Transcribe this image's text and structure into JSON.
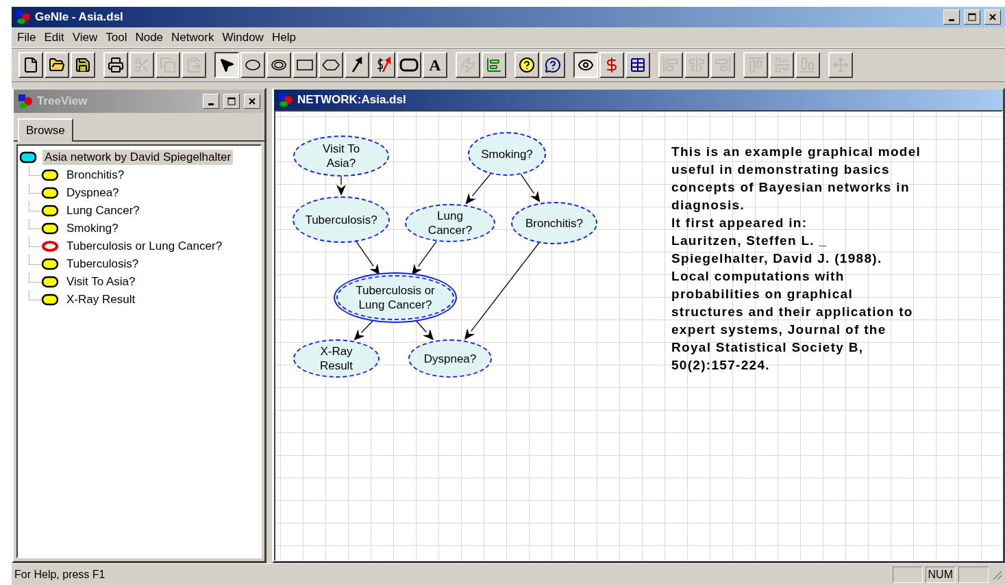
{
  "window": {
    "title": "GeNIe - Asia.dsl"
  },
  "menu": [
    "File",
    "Edit",
    "View",
    "Tool",
    "Node",
    "Network",
    "Window",
    "Help"
  ],
  "toolbar": [
    [
      {
        "kind": "new",
        "pressed": false,
        "disabled": false
      },
      {
        "kind": "open",
        "pressed": false,
        "disabled": false
      },
      {
        "kind": "save",
        "pressed": false,
        "disabled": false
      }
    ],
    [
      {
        "kind": "print",
        "pressed": false,
        "disabled": false
      },
      {
        "kind": "cut",
        "pressed": false,
        "disabled": true
      },
      {
        "kind": "copy",
        "pressed": false,
        "disabled": true
      },
      {
        "kind": "paste",
        "pressed": false,
        "disabled": true
      }
    ],
    [
      {
        "kind": "select",
        "pressed": true,
        "disabled": false
      },
      {
        "kind": "chance",
        "pressed": false,
        "disabled": false
      },
      {
        "kind": "deterministic",
        "pressed": false,
        "disabled": false
      },
      {
        "kind": "decision",
        "pressed": false,
        "disabled": false
      },
      {
        "kind": "utility",
        "pressed": false,
        "disabled": false
      },
      {
        "kind": "arc",
        "pressed": false,
        "disabled": false
      },
      {
        "kind": "value-arc",
        "pressed": false,
        "disabled": false
      },
      {
        "kind": "submodel",
        "pressed": false,
        "disabled": false
      },
      {
        "kind": "text",
        "label": "A",
        "pressed": false,
        "disabled": false
      }
    ],
    [
      {
        "kind": "strength",
        "pressed": false,
        "disabled": true
      },
      {
        "kind": "chart",
        "pressed": false,
        "disabled": false
      }
    ],
    [
      {
        "kind": "help",
        "pressed": false,
        "disabled": false
      },
      {
        "kind": "whats-this",
        "pressed": false,
        "disabled": false
      }
    ],
    [
      {
        "kind": "update",
        "pressed": true,
        "disabled": false
      },
      {
        "kind": "value-update",
        "pressed": false,
        "disabled": false
      },
      {
        "kind": "table",
        "pressed": false,
        "disabled": false
      }
    ],
    [
      {
        "kind": "align-left",
        "pressed": false,
        "disabled": true
      },
      {
        "kind": "align-center",
        "pressed": false,
        "disabled": true
      },
      {
        "kind": "align-right",
        "pressed": false,
        "disabled": true
      }
    ],
    [
      {
        "kind": "align-top",
        "pressed": false,
        "disabled": true
      },
      {
        "kind": "align-middle",
        "pressed": false,
        "disabled": true
      },
      {
        "kind": "align-bottom",
        "pressed": false,
        "disabled": true
      }
    ],
    [
      {
        "kind": "move",
        "pressed": false,
        "disabled": true
      }
    ]
  ],
  "tree_view": {
    "title": "TreeView",
    "tabs": [
      {
        "label": "Browse",
        "selected": true
      }
    ],
    "root": {
      "label": "Asia network by David Spiegelhalter",
      "kind": "network",
      "selected": true,
      "children": [
        {
          "label": "Bronchitis?",
          "kind": "chance",
          "selected": false
        },
        {
          "label": "Dyspnea?",
          "kind": "chance",
          "selected": false
        },
        {
          "label": "Lung Cancer?",
          "kind": "chance",
          "selected": false
        },
        {
          "label": "Smoking?",
          "kind": "chance",
          "selected": false
        },
        {
          "label": "Tuberculosis or Lung Cancer?",
          "kind": "deterministic",
          "selected": false
        },
        {
          "label": "Tuberculosis?",
          "kind": "chance",
          "selected": false
        },
        {
          "label": "Visit To Asia?",
          "kind": "chance",
          "selected": false
        },
        {
          "label": "X-Ray Result",
          "kind": "chance",
          "selected": false
        }
      ]
    }
  },
  "network": {
    "title": "NETWORK:Asia.dsl",
    "nodes": [
      {
        "label": "Visit To Asia?",
        "kind": "chance"
      },
      {
        "label": "Smoking?",
        "kind": "chance"
      },
      {
        "label": "Tuberculosis?",
        "kind": "chance"
      },
      {
        "label": "Lung Cancer?",
        "kind": "chance"
      },
      {
        "label": "Bronchitis?",
        "kind": "chance"
      },
      {
        "label": "Tuberculosis or Lung Cancer?",
        "kind": "deterministic"
      },
      {
        "label": "X-Ray Result",
        "kind": "chance"
      },
      {
        "label": "Dyspnea?",
        "kind": "chance"
      }
    ],
    "note": [
      "This is an example graphical model useful in demonstrating basics concepts of Bayesian networks in diagnosis.",
      "It first appeared in:",
      "Lauritzen, Steffen L. _ Spiegelhalter, David J. (1988). Local computations with probabilities on graphical structures and their application to expert systems, Journal of the Royal Statistical Society B, 50(2):157-224."
    ]
  },
  "status_bar": {
    "text": "For Help, press F1",
    "indicators": [
      "NUM"
    ]
  }
}
